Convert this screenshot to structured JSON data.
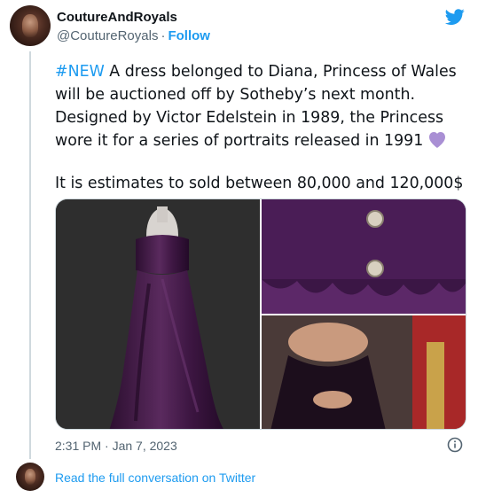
{
  "header": {
    "display_name": "CoutureAndRoyals",
    "handle": "@CoutureRoyals",
    "separator": "·",
    "follow_label": "Follow"
  },
  "tweet": {
    "hashtag": "#NEW",
    "line1_rest": " A dress belonged to Diana, Princess of Wales will be auctioned off by Sotheby’s next month. Designed by Victor Edelstein in 1989, the Princess wore it for a series of portraits released in 1991",
    "line2": "It is estimates to sold between 80,000 and 120,000$",
    "emoji": "purple-heart"
  },
  "media": [
    {
      "alt": "purple velvet strapless gown on mannequin"
    },
    {
      "alt": "velvet bodice with jeweled buttons"
    },
    {
      "alt": "Diana seated in velvet dress"
    }
  ],
  "meta": {
    "timestamp": "2:31 PM · Jan 7, 2023"
  },
  "footer": {
    "link_label": "Read the full conversation on Twitter"
  },
  "colors": {
    "accent": "#1d9bf0",
    "text": "#0f1419",
    "secondary": "#536471"
  }
}
